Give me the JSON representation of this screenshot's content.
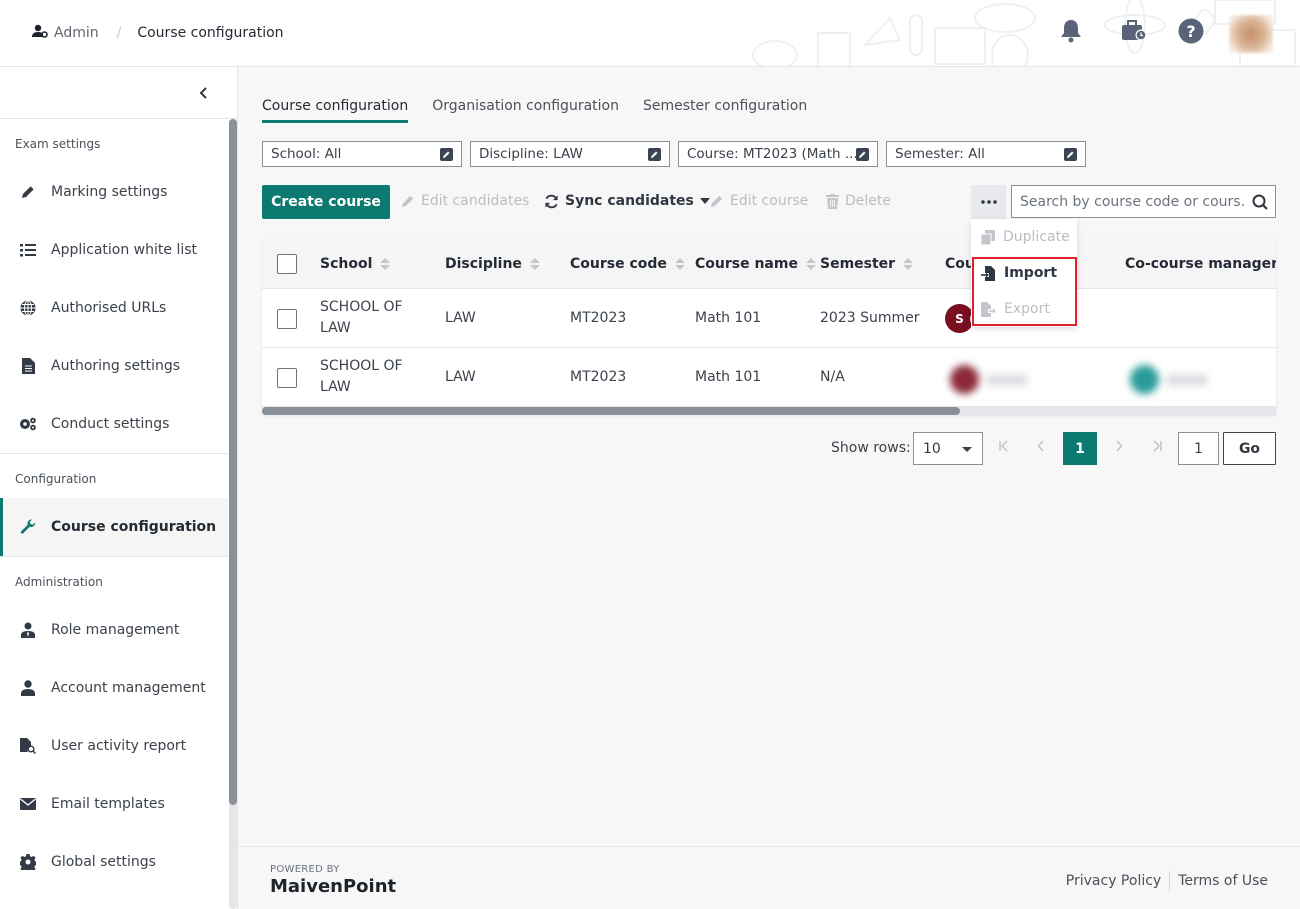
{
  "header": {
    "breadcrumb": [
      {
        "label": "Admin",
        "icon": "user-gear-icon"
      },
      {
        "label": "Course configuration"
      }
    ],
    "separator": "/",
    "icons": [
      "bell-icon",
      "briefcase-clock-icon",
      "help-icon",
      "user-avatar"
    ]
  },
  "sidebar": {
    "sections": [
      {
        "title": "Exam settings",
        "items": [
          {
            "label": "Marking settings",
            "icon": "pencil-icon"
          },
          {
            "label": "Application white list",
            "icon": "list-icon"
          },
          {
            "label": "Authorised URLs",
            "icon": "globe-icon"
          },
          {
            "label": "Authoring settings",
            "icon": "file-icon"
          },
          {
            "label": "Conduct settings",
            "icon": "gears-icon"
          }
        ]
      },
      {
        "title": "Configuration",
        "items": [
          {
            "label": "Course configuration",
            "icon": "wrench-icon",
            "active": true
          }
        ]
      },
      {
        "title": "Administration",
        "items": [
          {
            "label": "Role management",
            "icon": "user-tie-icon"
          },
          {
            "label": "Account management",
            "icon": "user-icon"
          },
          {
            "label": "User activity report",
            "icon": "file-search-icon"
          },
          {
            "label": "Email templates",
            "icon": "envelope-icon"
          },
          {
            "label": "Global settings",
            "icon": "gear-icon"
          }
        ]
      }
    ]
  },
  "tabs": [
    {
      "label": "Course configuration",
      "active": true
    },
    {
      "label": "Organisation configuration"
    },
    {
      "label": "Semester configuration"
    }
  ],
  "filters": [
    {
      "label": "School: All"
    },
    {
      "label": "Discipline: LAW"
    },
    {
      "label": "Course: MT2023 (Math ..."
    },
    {
      "label": "Semester: All"
    }
  ],
  "toolbar": {
    "create": "Create course",
    "edit_candidates": "Edit candidates",
    "sync_candidates": "Sync candidates",
    "edit_course": "Edit course",
    "delete": "Delete",
    "search_placeholder": "Search by course code or cours..."
  },
  "more_menu": {
    "items": [
      {
        "label": "Duplicate",
        "enabled": false
      },
      {
        "label": "Import",
        "enabled": true
      },
      {
        "label": "Export",
        "enabled": false
      }
    ]
  },
  "table": {
    "columns": [
      "School",
      "Discipline",
      "Course code",
      "Course name",
      "Semester",
      "Course manager",
      "Co-course manager"
    ],
    "column_visible_label_course_manager": "Cou",
    "rows": [
      {
        "school": "SCHOOL OF LAW",
        "school_l1": "SCHOOL OF",
        "school_l2": "LAW",
        "discipline": "LAW",
        "code": "MT2023",
        "name": "Math 101",
        "semester": "2023 Summer",
        "manager_initial": "S",
        "manager_color": "#7a0f22",
        "co_manager": ""
      },
      {
        "school": "SCHOOL OF LAW",
        "school_l1": "SCHOOL OF",
        "school_l2": "LAW",
        "discipline": "LAW",
        "code": "MT2023",
        "name": "Math 101",
        "semester": "N/A",
        "manager_initial": "",
        "manager_color": "#8c2a3a",
        "co_manager_color": "#2a9a9a"
      }
    ]
  },
  "pagination": {
    "show_rows_label": "Show rows:",
    "rows_per_page": "10",
    "current_page": "1",
    "goto_value": "1",
    "go_label": "Go"
  },
  "footer": {
    "powered_by": "POWERED BY",
    "brand": "MaivenPoint",
    "links": [
      "Privacy Policy",
      "Terms of Use"
    ]
  },
  "colors": {
    "accent": "#0d7a72",
    "highlight": "#e0202a"
  }
}
